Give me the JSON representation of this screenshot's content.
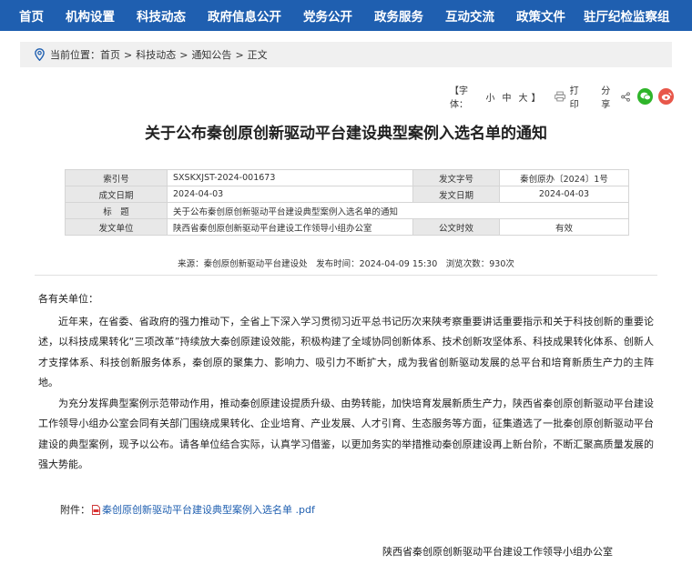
{
  "nav": {
    "items": [
      "首页",
      "机构设置",
      "科技动态",
      "政府信息公开",
      "党务公开",
      "政务服务",
      "互动交流",
      "政策文件",
      "驻厅纪检监察组"
    ]
  },
  "breadcrumb": {
    "prefix": "当前位置：",
    "items": [
      "首页",
      "科技动态",
      "通知公告",
      "正文"
    ],
    "separator": ">"
  },
  "tools": {
    "font_label": "【字体：",
    "font_small": "小",
    "font_medium": "中",
    "font_large": "大",
    "font_end": "】",
    "print": "打印",
    "share": "分享"
  },
  "article": {
    "title": "关于公布秦创原创新驱动平台建设典型案例入选名单的通知"
  },
  "meta_table": {
    "index_label": "索引号",
    "index_value": "SXSKXJST-2024-001673",
    "docno_label": "发文字号",
    "docno_value": "秦创原办〔2024〕1号",
    "created_label": "成文日期",
    "created_value": "2024-04-03",
    "issued_label": "发文日期",
    "issued_value": "2024-04-03",
    "title_label": "标　题",
    "title_value": "关于公布秦创原创新驱动平台建设典型案例入选名单的通知",
    "unit_label": "发文单位",
    "unit_value": "陕西省秦创原创新驱动平台建设工作领导小组办公室",
    "validity_label": "公文时效",
    "validity_value": "有效"
  },
  "source_line": "来源：秦创原创新驱动平台建设处　发布时间：2024-04-09 15:30　浏览次数：930次",
  "body": {
    "salutation": "各有关单位：",
    "paragraphs": [
      "近年来，在省委、省政府的强力推动下，全省上下深入学习贯彻习近平总书记历次来陕考察重要讲话重要指示和关于科技创新的重要论述，以科技成果转化“三项改革”持续放大秦创原建设效能，积极构建了全域协同创新体系、技术创新攻坚体系、科技成果转化体系、创新人才支撑体系、科技创新服务体系，秦创原的聚集力、影响力、吸引力不断扩大，成为我省创新驱动发展的总平台和培育新质生产力的主阵地。",
      "为充分发挥典型案例示范带动作用，推动秦创原建设提质升级、由势转能，加快培育发展新质生产力，陕西省秦创原创新驱动平台建设工作领导小组办公室会同有关部门围绕成果转化、企业培育、产业发展、人才引育、生态服务等方面，征集遴选了一批秦创原创新驱动平台建设的典型案例，现予以公布。请各单位结合实际，认真学习借鉴，以更加务实的举措推动秦创原建设再上新台阶，不断汇聚高质量发展的强大势能。"
    ]
  },
  "attachment": {
    "label": "附件：",
    "file_name": "秦创原创新驱动平台建设典型案例入选名单 .pdf"
  },
  "signature": "陕西省秦创原创新驱动平台建设工作领导小组办公室",
  "colors": {
    "nav_bg": "#1f5fb0",
    "wechat": "#2fb52a",
    "weibo": "#e8574a",
    "link": "#1f5fb0"
  }
}
